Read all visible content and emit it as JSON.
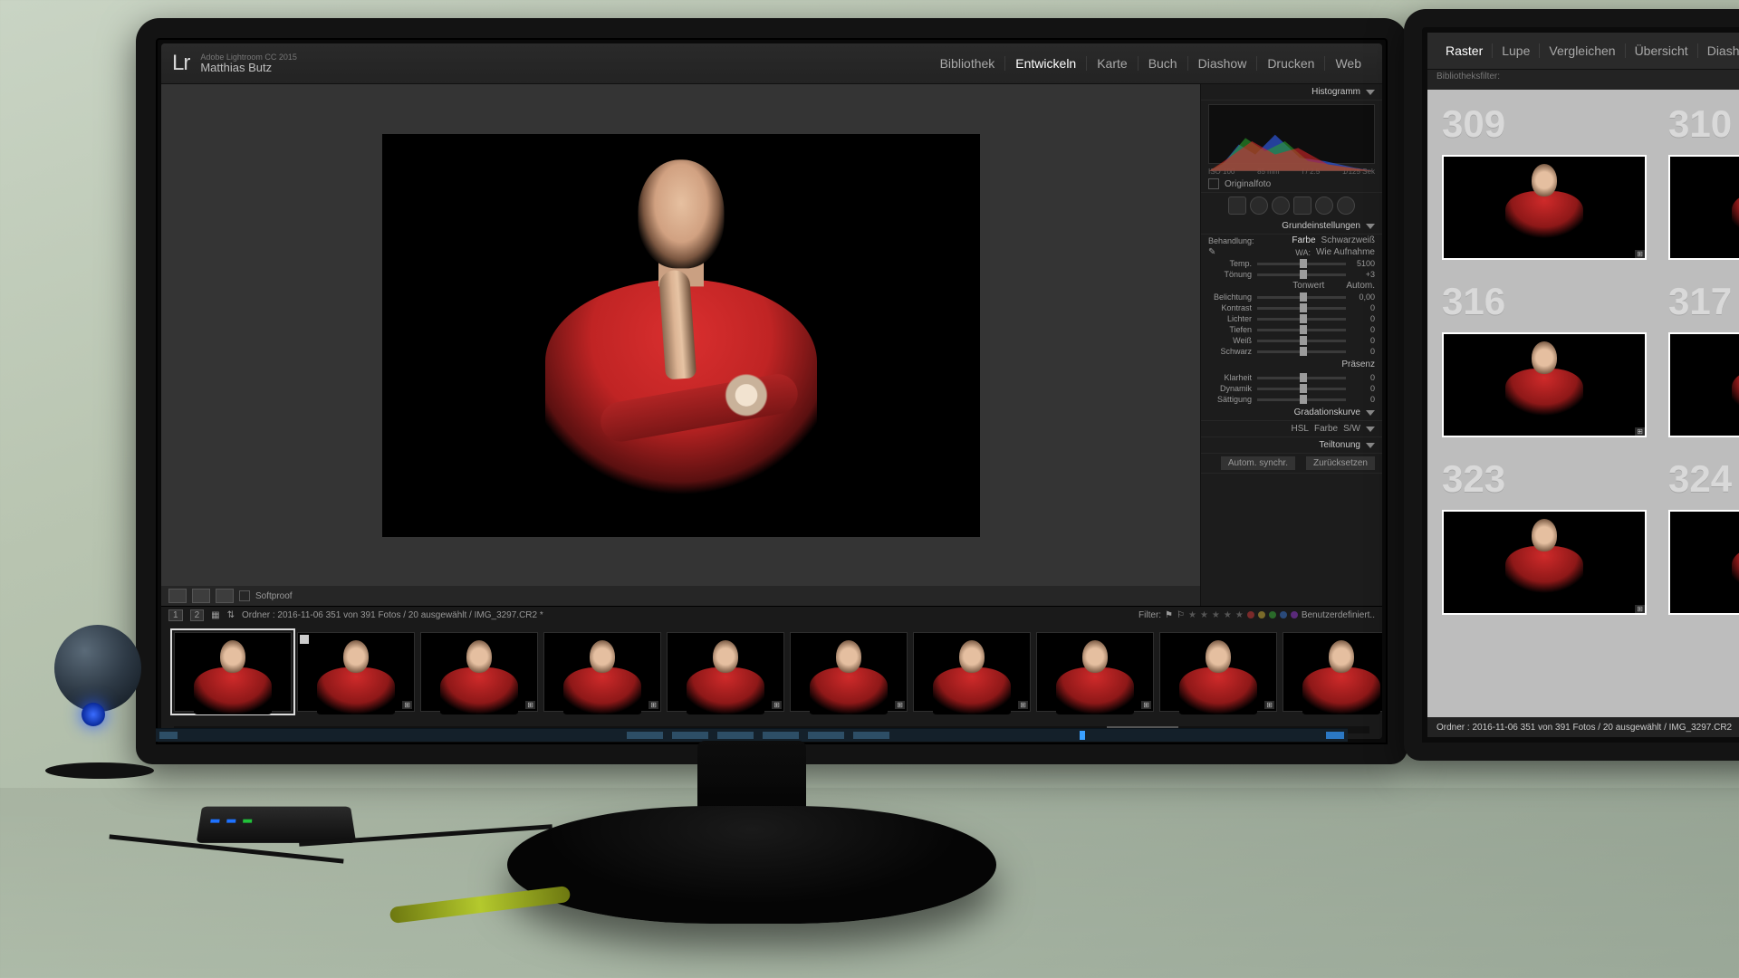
{
  "app": {
    "edition": "Adobe Lightroom CC 2015",
    "user": "Matthias Butz",
    "logo": "Lr"
  },
  "modules": [
    "Bibliothek",
    "Entwickeln",
    "Karte",
    "Buch",
    "Diashow",
    "Drucken",
    "Web"
  ],
  "active_module": "Entwickeln",
  "toolbar": {
    "softproof": "Softproof"
  },
  "panel": {
    "histogram": "Histogramm",
    "exif": {
      "iso": "ISO 100",
      "lens": "85 mm",
      "aperture": "f / 2.5",
      "shutter": "1/125 Sek"
    },
    "original": "Originalfoto",
    "basic": "Grundeinstellungen",
    "treatment": "Behandlung:",
    "treat_color": "Farbe",
    "treat_bw": "Schwarzweiß",
    "wb_label": "WA:",
    "wb_value": "Wie Aufnahme",
    "sliders_wb": [
      {
        "lbl": "Temp.",
        "val": "5100"
      },
      {
        "lbl": "Tönung",
        "val": "+3"
      }
    ],
    "tone": "Tonwert",
    "autom": "Autom.",
    "sliders_tone": [
      {
        "lbl": "Belichtung",
        "val": "0,00"
      },
      {
        "lbl": "Kontrast",
        "val": "0"
      },
      {
        "lbl": "Lichter",
        "val": "0"
      },
      {
        "lbl": "Tiefen",
        "val": "0"
      },
      {
        "lbl": "Weiß",
        "val": "0"
      },
      {
        "lbl": "Schwarz",
        "val": "0"
      }
    ],
    "presence": "Präsenz",
    "sliders_presence": [
      {
        "lbl": "Klarheit",
        "val": "0"
      },
      {
        "lbl": "Dynamik",
        "val": "0"
      },
      {
        "lbl": "Sättigung",
        "val": "0"
      }
    ],
    "curve": "Gradationskurve",
    "hsl": "HSL",
    "hsl_color": "Farbe",
    "hsl_bw": "S/W",
    "split": "Teiltonung",
    "sync": "Autom. synchr.",
    "reset": "Zurücksetzen"
  },
  "filmstrip": {
    "info": "Ordner : 2016-11-06   351 von 391 Fotos / 20 ausgewählt / IMG_3297.CR2 *",
    "filter_label": "Filter:",
    "filter_value": "Benutzerdefiniert..",
    "mode1": "1",
    "mode2": "2",
    "thumbs": 10
  },
  "secondary": {
    "tabs": [
      "Raster",
      "Lupe",
      "Vergleichen",
      "Übersicht",
      "Diashow"
    ],
    "active_tab": "Raster",
    "filter": "Bibliotheksfilter:",
    "cells": [
      "309",
      "310",
      "316",
      "317",
      "323",
      "324"
    ],
    "foot": "Ordner : 2016-11-06   351 von 391 Fotos / 20 ausgewählt / IMG_3297.CR2"
  }
}
